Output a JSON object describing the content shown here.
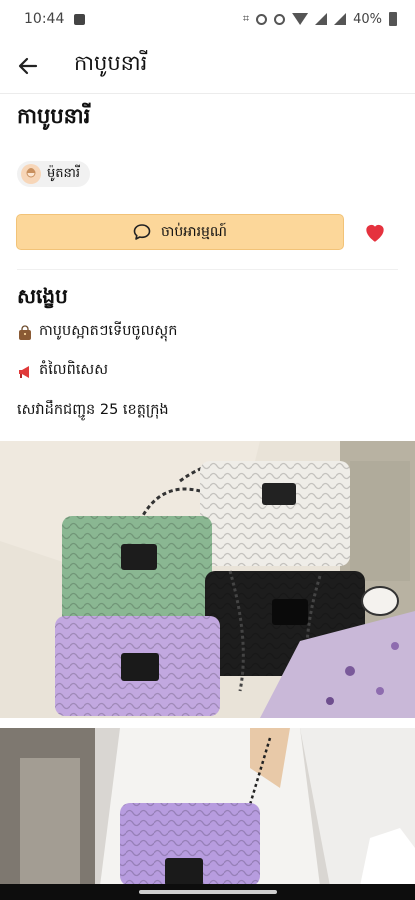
{
  "status": {
    "time": "10:44",
    "battery": "40%"
  },
  "appbar": {
    "title": "កាបូបនារី"
  },
  "product": {
    "title": "កាបូបនារី",
    "category_label": "ម៉ូតនារី",
    "comment_button_label": "ចាប់អារម្មណ៍"
  },
  "summary": {
    "heading": "សង្ខេប",
    "lines": [
      "កាបូបស្អាតៗទើបចូលស្តុក",
      "តំលៃពិសេស",
      "សេវាដឹកជញ្ជូន 25 ខេត្តក្រុង"
    ]
  },
  "colors": {
    "accent": "#fcd79a",
    "heart": "#e5323e"
  },
  "icons": {
    "back": "arrow-left-icon",
    "comment": "chat-bubble-icon",
    "favorite": "heart-icon"
  }
}
